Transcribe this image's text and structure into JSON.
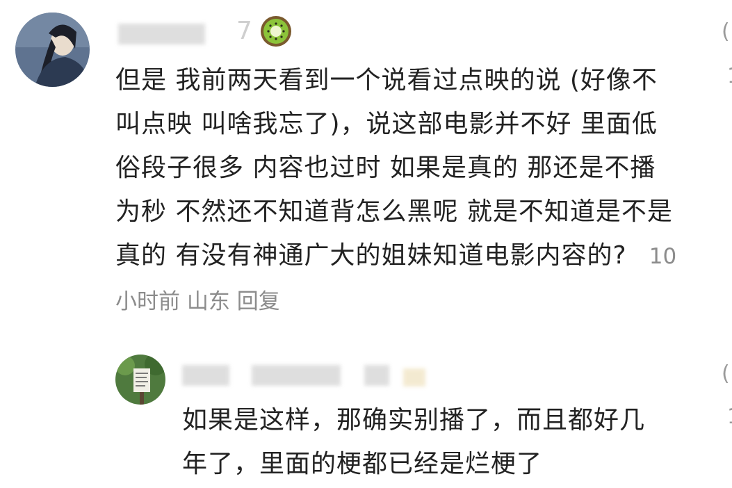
{
  "comments": [
    {
      "user_hint": "7",
      "text": "但是 我前两天看到一个说看过点映的说 (好像不叫点映 叫啥我忘了)，说这部电影并不好 里面低俗段子很多 内容也过时 如果是真的 那还是不播为秒 不然还不知道背怎么黑呢 就是不知道是不是真的 有没有神通广大的姐妹知道电影内容的?",
      "time": "10小时前",
      "location": "山东",
      "reply_label": "回复"
    },
    {
      "text": "如果是这样，那确实别播了，而且都好几年了，里面的梗都已经是烂梗了"
    }
  ],
  "colors": {
    "text": "#222222",
    "meta": "#8c8c8c",
    "kiwi_skin": "#7a5a2e",
    "kiwi_flesh": "#8cc43a"
  }
}
